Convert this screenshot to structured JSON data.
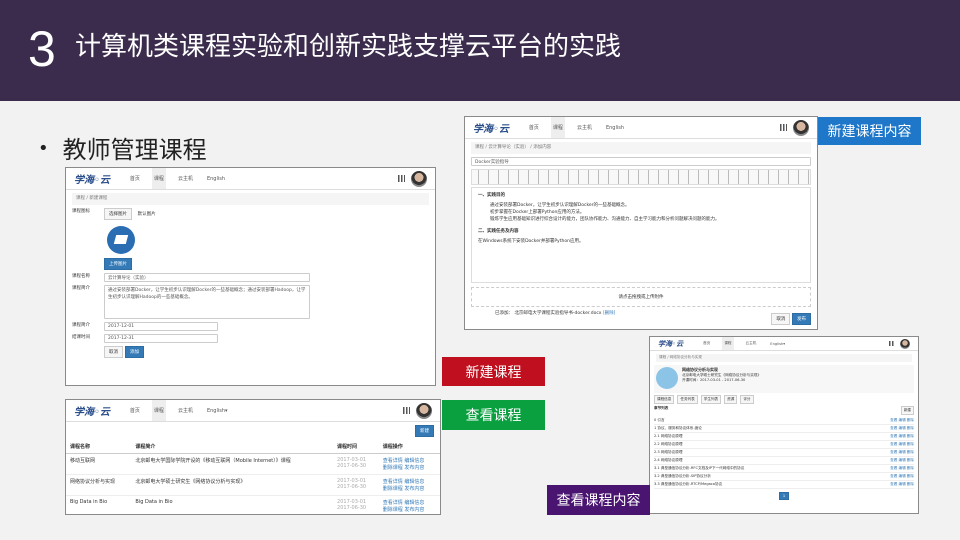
{
  "slide": {
    "number": "3",
    "title": "计算机类课程实验和创新实践支撑云平台的实践",
    "bullet": "教师管理课程"
  },
  "tags": {
    "new_course_content": "新建课程内容",
    "new_course": "新建课程",
    "view_course": "查看课程",
    "view_course_content": "查看课程内容"
  },
  "app": {
    "logo": "学海◦云",
    "nav": [
      "首页",
      "课程",
      "云主机",
      "English"
    ],
    "nav_english_dropdown": "English▾"
  },
  "new_course": {
    "breadcrumb": "课程 / 新建课程",
    "icon_label": "课程图标",
    "tabs": [
      "选择图片",
      "默认图片"
    ],
    "upload_button": "上传图片",
    "name_label": "课程名称",
    "name_value": "云计算导论（实验）",
    "desc_label": "课程简介",
    "desc_value": "通过安装部署Docker，让学生初步认识理解Docker的一些基础概念；通过安装部署Hadoop，让学生初步认识理解Hadoop的一些基础概念。",
    "start_label": "课程简介",
    "start_value": "2017-12-01",
    "end_label": "结课时间",
    "end_value": "2017-12-31",
    "cancel": "取消",
    "save": "添加"
  },
  "new_content": {
    "breadcrumb": "课程 / 云计算导论（实验） / 添加内容",
    "title_value": "Docker实验指导",
    "section1": "一、实践目的",
    "items": [
      "通过安装部署Docker，让学生初步认识理解Docker的一些基础概念。",
      "初步掌握在Docker上部署Python应用的方法。",
      "锻炼学生应用基础知识进行综合设计的能力，团队协作能力、沟通能力、自主学习能力和分析问题解决问题的能力。"
    ],
    "section2": "二、实践任务及内容",
    "task": "在Windows系统下安装Docker并部署Python应用。",
    "upload_hint": "请点击拖拽或上传附件",
    "attachment_label": "已添加：",
    "attachment": "北京邮电大学课程实验指导书-docker.docx",
    "attachment_delete": "[删除]",
    "cancel": "取消",
    "publish": "发布"
  },
  "view_courses": {
    "add_button": "新建",
    "headers": [
      "课程名称",
      "课程简介",
      "课程时间",
      "课程操作"
    ],
    "rows": [
      {
        "name": "移动互联网",
        "desc": "北京邮电大学国际学院开设的《移动互联网（Mobile Internet）》课程",
        "time1": "2017-03-01",
        "time2": "2017-06-30",
        "op1": "查看详情 编辑信息",
        "op2": "删除课程 发布内容"
      },
      {
        "name": "网络协议分析与实现",
        "desc": "北京邮电大学硕士研究生《网络协议分析与实现》",
        "time1": "2017-03-01",
        "time2": "2017-06-30",
        "op1": "查看详情 编辑信息",
        "op2": "删除课程 发布内容"
      },
      {
        "name": "Big Data in Bio",
        "desc": "Big Data in Bio",
        "time1": "2017-03-01",
        "time2": "2017-06-30",
        "op1": "查看详情 编辑信息",
        "op2": "删除课程 发布内容"
      }
    ]
  },
  "view_content": {
    "breadcrumb": "课程 / 网络协议分析与实现",
    "course_title": "网络协议分析与实现",
    "meta": [
      "北京邮电大学硕士研究生《网络协议分析与实现》",
      "开课时间：2017-03-01 - 2017-06-30"
    ],
    "tabs": [
      "课程信息",
      "任务列表",
      "学生列表",
      "资源",
      "评分"
    ],
    "list_title": "章节列表",
    "new_btn": "新建",
    "chapters": [
      "0 引言",
      "1 协议、服务和协议体系-绪论",
      "2.1 网络协议原理",
      "2.2 网络协议原理",
      "2.3 网络协议原理",
      "2.4 网络协议原理",
      "3.1 典型通信协议分析-RFC文档及IP下一代网络中的协议",
      "3.2 典型通信协议分析-SIP协议分析",
      "3.3 典型通信协议分析-RTCP/Megaco协议"
    ],
    "row_ops": "查看 编辑 删除",
    "page": "1"
  }
}
